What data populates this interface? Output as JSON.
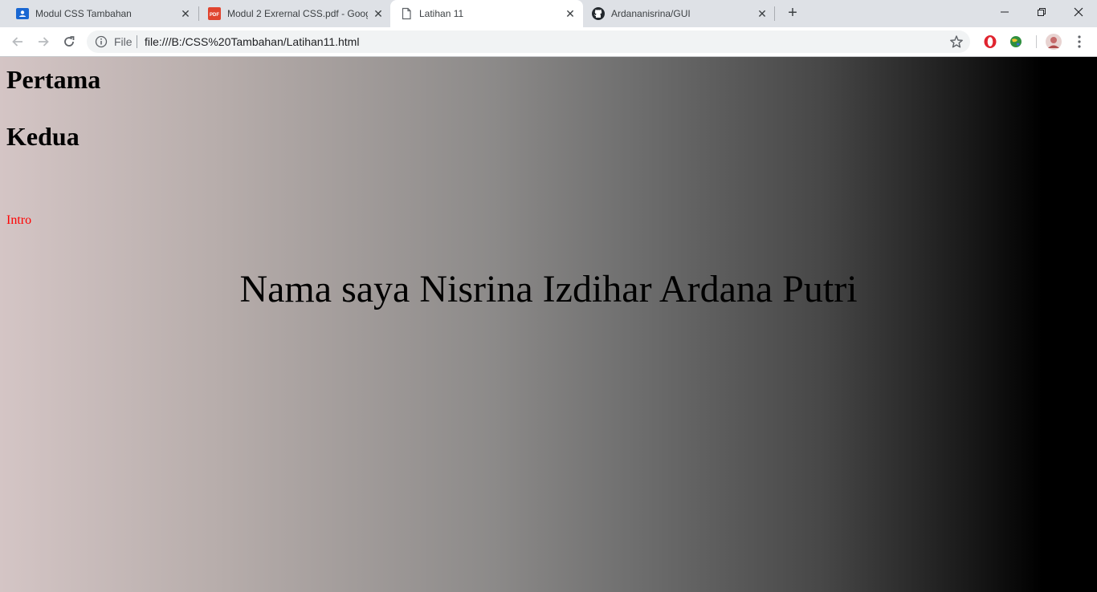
{
  "tabs": [
    {
      "title": "Modul CSS Tambahan",
      "icon": "google-classroom-icon",
      "active": false
    },
    {
      "title": "Modul 2 Exrernal CSS.pdf - Goog",
      "icon": "pdf-icon",
      "active": false
    },
    {
      "title": "Latihan 11",
      "icon": "page-icon",
      "active": true
    },
    {
      "title": "Ardananisrina/GUI",
      "icon": "github-icon",
      "active": false
    }
  ],
  "toolbar": {
    "scheme_label": "File",
    "url": "file:///B:/CSS%20Tambahan/Latihan11.html"
  },
  "page": {
    "heading_first": "Pertama",
    "heading_second": "Kedua",
    "intro": "Intro",
    "main_text": "Nama saya Nisrina Izdihar Ardana Putri"
  },
  "colors": {
    "intro_color": "#ff0000",
    "gradient_start": "#d4c5c5",
    "gradient_end": "#000000"
  }
}
